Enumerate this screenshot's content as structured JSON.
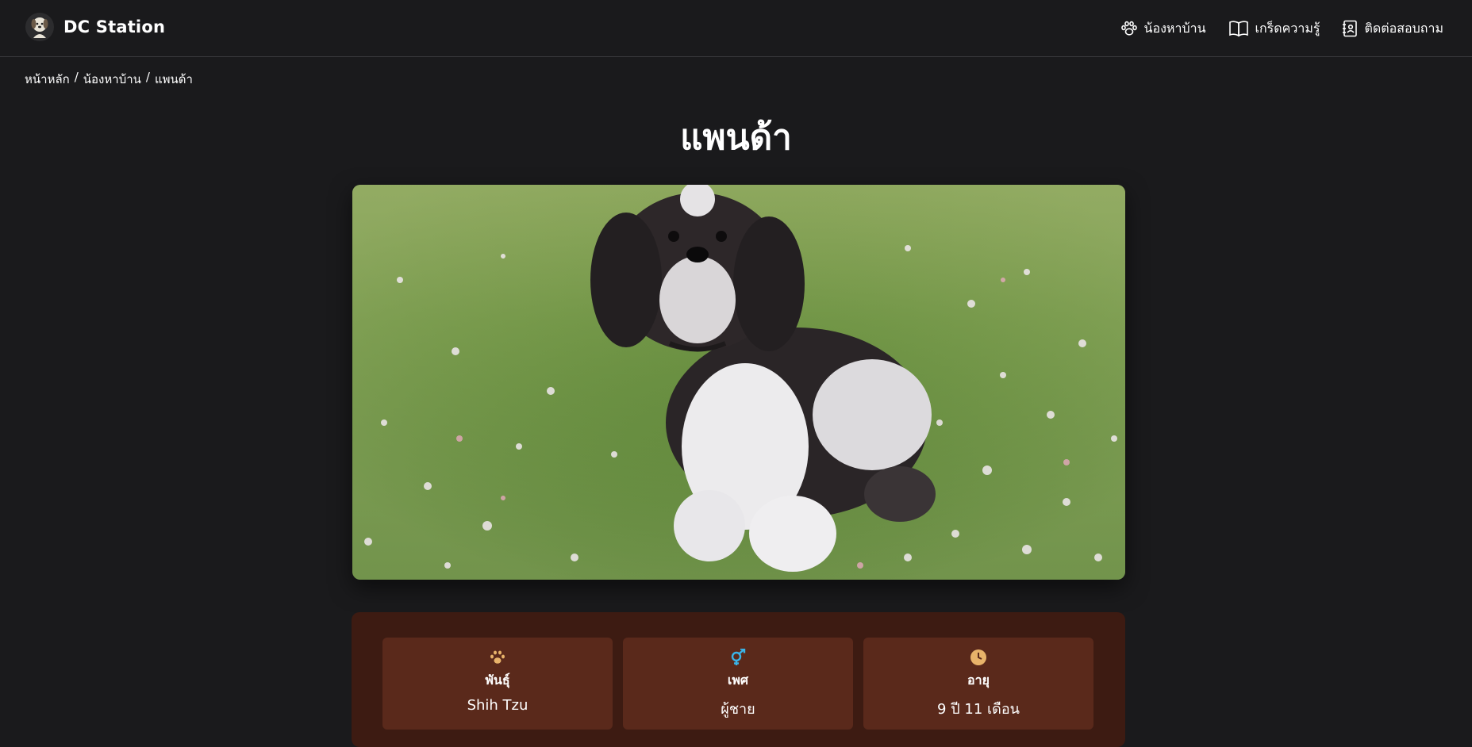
{
  "brand": {
    "name": "DC Station",
    "logo_icon": "dog-logo-icon"
  },
  "nav": [
    {
      "label": "น้องหาบ้าน",
      "icon": "paw-icon"
    },
    {
      "label": "เกร็ดความรู้",
      "icon": "book-icon"
    },
    {
      "label": "ติดต่อสอบถาม",
      "icon": "contact-book-icon"
    }
  ],
  "breadcrumb": {
    "home": "หน้าหลัก",
    "section": "น้องหาบ้าน",
    "current": "แพนด้า",
    "separator": "/"
  },
  "pet": {
    "name": "แพนด้า",
    "photo_alt": "Black and white Shih Tzu sitting on grass",
    "details": [
      {
        "label": "พันธุ์",
        "value": "Shih Tzu",
        "icon": "paw-icon",
        "icon_color": "#e8b36a"
      },
      {
        "label": "เพศ",
        "value": "ผู้ชาย",
        "icon": "gender-icon",
        "icon_color": "#3ab4e8"
      },
      {
        "label": "อายุ",
        "value": "9 ปี 11 เดือน",
        "icon": "clock-icon",
        "icon_color": "#e8b36a"
      }
    ]
  },
  "colors": {
    "background": "#1a1a1c",
    "card": "#3d1b12",
    "tile": "#5a291b",
    "accent": "#e8b36a"
  }
}
